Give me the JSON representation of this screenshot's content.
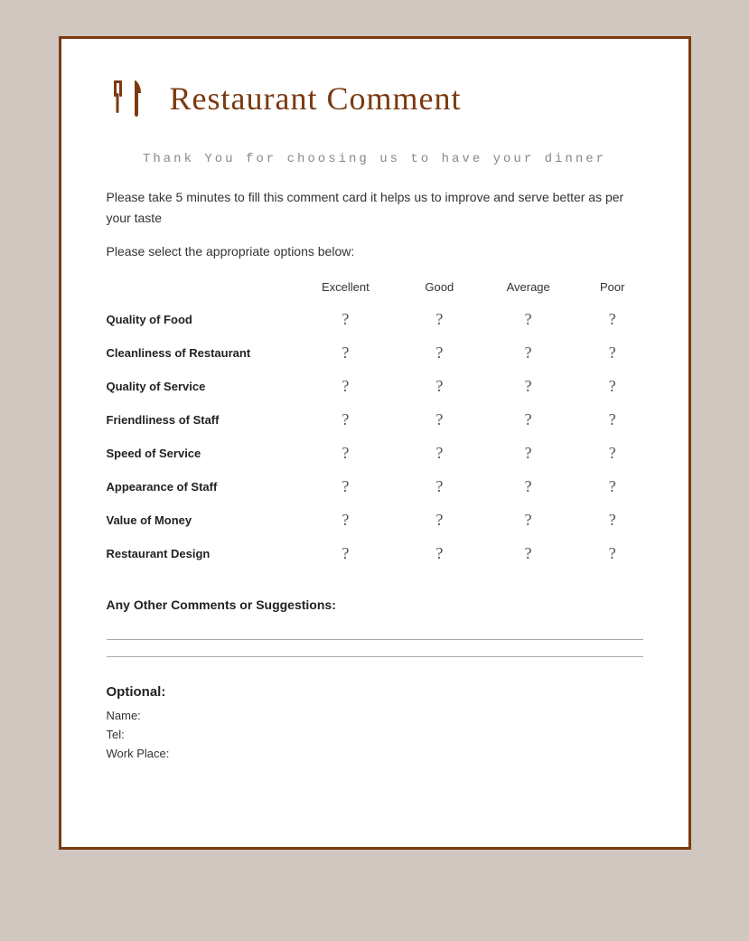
{
  "header": {
    "title": "Restaurant Comment"
  },
  "subtitle": "Thank You for choosing us to have your dinner",
  "description": "Please take 5 minutes to fill this comment card it helps us to improve and serve better as per your taste",
  "instruction": "Please select the appropriate options below:",
  "columns": [
    "Excellent",
    "Good",
    "Average",
    "Poor"
  ],
  "rows": [
    {
      "label": "Quality of Food"
    },
    {
      "label": "Cleanliness of Restaurant"
    },
    {
      "label": "Quality of Service"
    },
    {
      "label": "Friendliness of Staff"
    },
    {
      "label": "Speed of Service"
    },
    {
      "label": "Appearance of Staff"
    },
    {
      "label": "Value of Money"
    },
    {
      "label": "Restaurant Design"
    }
  ],
  "rating_symbol": "?",
  "comments_label": "Any Other Comments or Suggestions:",
  "optional": {
    "title": "Optional:",
    "fields": [
      "Name:",
      "Tel:",
      "Work Place:"
    ]
  },
  "colors": {
    "brand": "#7B3A10",
    "text": "#333",
    "light_text": "#888"
  }
}
